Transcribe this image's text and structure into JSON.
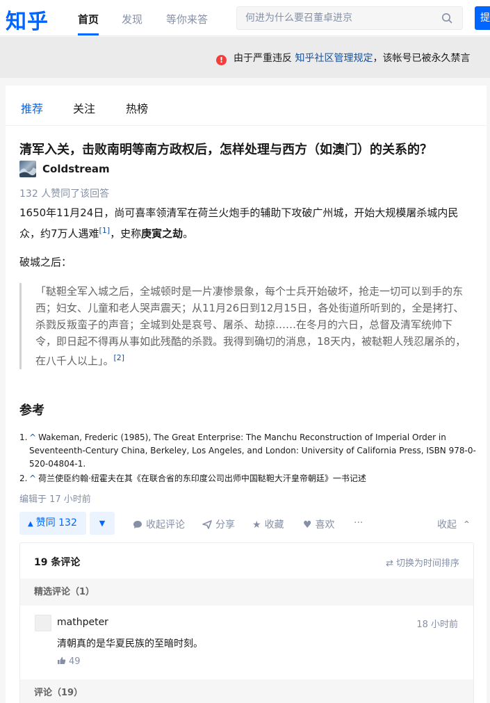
{
  "brand": {
    "logo": "知乎"
  },
  "nav": {
    "items": [
      {
        "label": "首页",
        "active": true
      },
      {
        "label": "发现",
        "active": false
      },
      {
        "label": "等你来答",
        "active": false
      }
    ],
    "search_placeholder": "何进为什么要召董卓进京",
    "ask_label": "提问"
  },
  "banner": {
    "prefix": "由于严重违反 ",
    "link": "知乎社区管理规定",
    "suffix": "，该帐号已被永久禁言"
  },
  "feed_tabs": [
    {
      "label": "推荐",
      "active": true
    },
    {
      "label": "关注",
      "active": false
    },
    {
      "label": "热榜",
      "active": false
    }
  ],
  "question": {
    "title": "清军入关，击败南明等南方政权后，怎样处理与西方（如澳门）的关系的？"
  },
  "answer": {
    "author": "Coldstream",
    "vote_text": "132 人赞同了该回答",
    "p1_a": "1650年11月24日，尚可喜率领清军在荷兰火炮手的辅助下攻破广州城，开始大规模屠杀城内民众，约7万人遇难",
    "p1_sup": "[1]",
    "p1_b": "，史称",
    "p1_bold": "庚寅之劫",
    "p1_c": "。",
    "p2": "破城之后：",
    "quote": "「鞑靼全军入城之后，全城顿时是一片凄惨景象，每个士兵开始破坏，抢走一切可以到手的东西；妇女、儿童和老人哭声震天；从11月26日到12月15日，各处街道所听到的，全是拷打、杀戮反叛蛮子的声音；全城到处是哀号、屠杀、劫掠……在冬月的六日，总督及清军统帅下令，即日起不得再从事如此残酷的杀戮。我得到确切的消息，18天内，被鞑靼人残忍屠杀的，在八千人以上」。",
    "quote_sup": "[2]",
    "refs_heading": "参考",
    "refs": [
      {
        "num": "1.",
        "text": "Wakeman, Frederic (1985), The Great Enterprise: The Manchu Reconstruction of Imperial Order in Seventeenth-Century China, Berkeley, Los Angeles, and London: University of California Press, ISBN 978-0-520-04804-1."
      },
      {
        "num": "2.",
        "text": "荷兰使臣约翰·纽霍夫在其《在联合省的东印度公司出师中国鞑靼大汗皇帝朝廷》一书记述"
      }
    ],
    "edited": "编辑于 17 小时前"
  },
  "actions": {
    "vote_up": "赞同 132",
    "collapse_comments": "收起评论",
    "share": "分享",
    "favorite": "收藏",
    "like": "喜欢",
    "more": "···",
    "collapse": "收起"
  },
  "comments": {
    "count_label": "19 条评论",
    "sort_label": "切换为时间排序",
    "featured_label": "精选评论（1）",
    "all_label": "评论（19）",
    "items": [
      {
        "user": "mathpeter",
        "time": "18 小时前",
        "text": "清朝真的是华夏民族的至暗时刻。",
        "likes": "49"
      }
    ]
  },
  "colors": {
    "brand": "#0066ff",
    "link": "#175199",
    "muted": "#8590a6",
    "warning": "#f1403c"
  }
}
